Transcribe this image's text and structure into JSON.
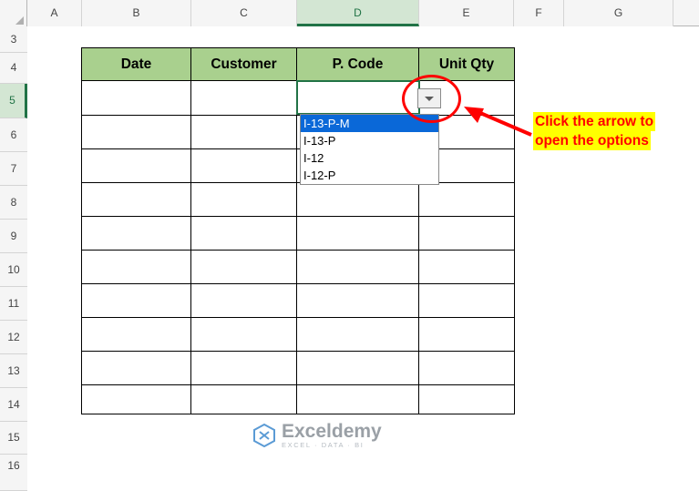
{
  "spreadsheet": {
    "column_headers": [
      "A",
      "B",
      "C",
      "D",
      "E",
      "F",
      "G"
    ],
    "selected_column": "D",
    "row_headers": [
      "3",
      "4",
      "5",
      "6",
      "7",
      "8",
      "9",
      "10",
      "11",
      "12",
      "13",
      "14",
      "15",
      "16"
    ],
    "selected_row": "5",
    "table": {
      "headers": [
        "Date",
        "Customer",
        "P. Code",
        "Unit Qty"
      ],
      "rows": [
        [
          "",
          "",
          "",
          ""
        ],
        [
          "",
          "",
          "",
          ""
        ],
        [
          "",
          "",
          "",
          ""
        ],
        [
          "",
          "",
          "",
          ""
        ],
        [
          "",
          "",
          "",
          ""
        ],
        [
          "",
          "",
          "",
          ""
        ],
        [
          "",
          "",
          "",
          ""
        ],
        [
          "",
          "",
          "",
          ""
        ],
        [
          "",
          "",
          "",
          ""
        ],
        [
          "",
          "",
          "",
          ""
        ]
      ],
      "header_fill": "#a9d08e"
    },
    "active_cell": "D5"
  },
  "dropdown": {
    "button_icon": "chevron-down-icon",
    "options": [
      "I-13-P-M",
      "I-13-P",
      "I-12",
      "I-12-P"
    ],
    "selected_option": "I-13-P-M",
    "highlight_color": "#0a68d8"
  },
  "annotation": {
    "text": "Click the arrow to\nopen the options",
    "line1": "Click the arrow to",
    "line2": "open the options",
    "background": "#ffff00",
    "text_color": "#ff0000",
    "highlight_shape": "red-ellipse",
    "arrow": "red-arrow-left"
  },
  "watermark": {
    "name": "Exceldemy",
    "tagline": "EXCEL · DATA · BI",
    "logo_icon": "exceldemy-logo-icon"
  }
}
